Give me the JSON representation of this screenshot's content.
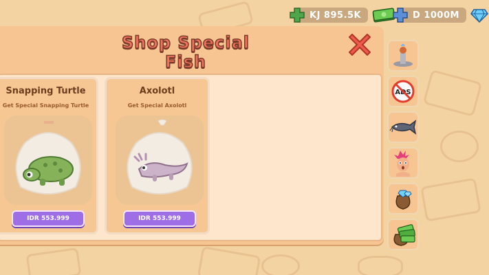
{
  "currency": {
    "kj_label": "KJ 895.5K",
    "diamond_label": "D 1000M"
  },
  "shop": {
    "title": "Shop Special Fish",
    "items": [
      {
        "name": "Snapping Turtle",
        "desc": "Get Special Snapping Turtle",
        "price": "IDR 553.999"
      },
      {
        "name": "Axolotl",
        "desc": "Get Special Axolotl",
        "price": "IDR 553.999"
      }
    ]
  },
  "side_menu": [
    "fountain-icon",
    "no-ads-icon",
    "catfish-icon",
    "character-icon",
    "gem-bag-icon",
    "cash-bag-icon"
  ],
  "colors": {
    "background": "#f4d3a3",
    "panel": "#f7c591",
    "title": "#f0735e",
    "price_button": "#9d6ee6",
    "close": "#ee5b4c"
  }
}
